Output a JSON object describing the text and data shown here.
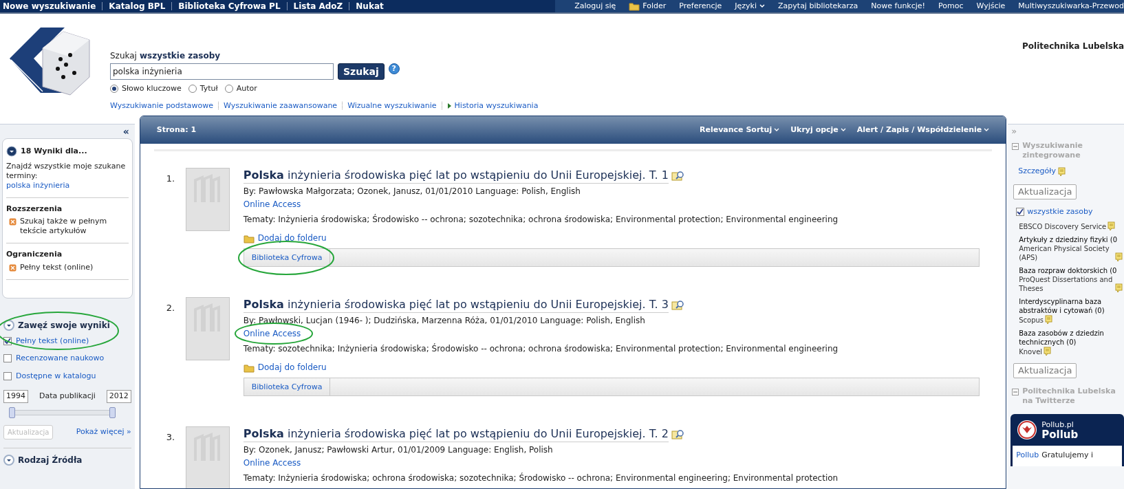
{
  "top_nav": {
    "left": [
      {
        "label": "Nowe wyszukiwanie"
      },
      {
        "label": "Katalog BPL"
      },
      {
        "label": "Biblioteka Cyfrowa PL"
      },
      {
        "label": "Lista AdoZ"
      },
      {
        "label": "Nukat"
      }
    ],
    "right": [
      {
        "label": "Zaloguj się",
        "kind": "plain"
      },
      {
        "label": "Folder",
        "kind": "folder"
      },
      {
        "label": "Preferencje",
        "kind": "plain"
      },
      {
        "label": "Języki",
        "kind": "dropdown"
      },
      {
        "label": "Zapytaj bibliotekarza",
        "kind": "plain"
      },
      {
        "label": "Nowe funkcje!",
        "kind": "plain"
      },
      {
        "label": "Pomoc",
        "kind": "plain"
      },
      {
        "label": "Wyjście",
        "kind": "plain"
      },
      {
        "label": "Multiwyszukiwarka-Przewod",
        "kind": "plain"
      }
    ]
  },
  "institution": "Politechnika Lubelska",
  "search": {
    "prefix": "Szukaj",
    "scope": "wszystkie zasoby",
    "value": "polska inżynieria",
    "button": "Szukaj",
    "help": "?",
    "options": [
      {
        "label": "Słowo kluczowe",
        "selected": true
      },
      {
        "label": "Tytuł",
        "selected": false
      },
      {
        "label": "Autor",
        "selected": false
      }
    ],
    "links": [
      {
        "label": "Wyszukiwanie podstawowe",
        "kind": "plain"
      },
      {
        "label": "Wyszukiwanie zaawansowane",
        "kind": "plain"
      },
      {
        "label": "Wizualne wyszukiwanie",
        "kind": "plain"
      },
      {
        "label": "Historia wyszukiwania",
        "kind": "arrow"
      }
    ]
  },
  "left_sidebar": {
    "collapse": "«",
    "results_heading": "18 Wyniki dla...",
    "find_text": "Znajdź wszystkie moje szukane terminy:",
    "query_link": "polska inżynieria",
    "sections": [
      {
        "heading": "Rozszerzenia",
        "items": [
          "Szukaj także w pełnym tekście artykułów"
        ]
      },
      {
        "heading": "Ograniczenia",
        "items": [
          "Pełny tekst (online)"
        ]
      }
    ],
    "narrow": {
      "heading": "Zawęź swoje wyniki",
      "circled": true,
      "filters": [
        {
          "label": "Pełny tekst (online)",
          "checked": true
        },
        {
          "label": "Recenzowane naukowo",
          "checked": false
        },
        {
          "label": "Dostępne w katalogu",
          "checked": false
        }
      ],
      "date_slider": {
        "thumbs": [
          {
            "level": 0
          },
          {
            "level": 1
          }
        ]
      },
      "date_from": "1994",
      "date_label": "Data publikacji",
      "date_to": "2012",
      "update_button": "Aktualizacja",
      "more_link": "Pokaż więcej »"
    },
    "next_heading": "Rodzaj Źródła"
  },
  "results": {
    "page_label": "Strona: 1",
    "toolbar": [
      "Relevance Sortuj",
      "Ukryj opcje",
      "Alert / Zapis / Współdzielenie"
    ],
    "items": [
      {
        "number": "1.",
        "title": "**Polska** inżynieria środowiska pięć lat po wstąpieniu do Unii Europejskiej. T. 1",
        "byline": "By: Pawłowska Małgorzata; Ozonek, Janusz, 01/01/2010 Language: Polish, English",
        "online_access": "Online Access",
        "access_circled": false,
        "subjects": "Tematy: Inżynieria środowiska; Środowisko -- ochrona; sozotechnika; ochrona środowiska; Environmental protection; Environmental engineering",
        "add_folder": "Dodaj do folderu",
        "source_tab": "Biblioteka Cyfrowa",
        "source_circled": true
      },
      {
        "number": "2.",
        "title": "**Polska** inżynieria środowiska pięć lat po wstąpieniu do Unii Europejskiej. T. 3",
        "byline": "By: Pawłowski, Lucjan (1946- ); Dudzińska, Marzenna Róża, 01/01/2010 Language: Polish, English",
        "online_access": "Online Access",
        "access_circled": true,
        "subjects": "Tematy: sozotechnika; Inżynieria środowiska; Środowisko -- ochrona; ochrona środowiska; Environmental protection; Environmental engineering",
        "add_folder": "Dodaj do folderu",
        "source_tab": "Biblioteka Cyfrowa",
        "source_circled": false
      },
      {
        "number": "3.",
        "title": "**Polska** inżynieria środowiska pięć lat po wstąpieniu do Unii Europejskiej. T. 2",
        "byline": "By: Ozonek, Janusz; Pawłowski Artur, 01/01/2009 Language: English, Polish",
        "online_access": "Online Access",
        "access_circled": false,
        "subjects": "Tematy: Inżynieria środowiska; ochrona środowiska; sozotechnika; Środowisko -- ochrona; Environmental engineering; Environmental protection"
      }
    ]
  },
  "right_sidebar": {
    "expand": "»",
    "integrated": {
      "heading": "Wyszukiwanie zintegrowane",
      "details": "Szczegóły",
      "update": "Aktualizacja",
      "all": {
        "label": "wszystkie zasoby",
        "checked": true
      },
      "sources": [
        {
          "name": "EBSCO Discovery Service"
        },
        {
          "category": "Artykuły z dziedziny fizyki (0",
          "name": "American Physical Society (APS)"
        },
        {
          "category": "Baza rozpraw doktorskich (0",
          "name": "ProQuest Dissertations and Theses"
        },
        {
          "category": "Interdyscyplinarna baza abstraktów i cytowań (0)",
          "name": "Scopus"
        },
        {
          "category": "Baza zasobów z dziedzin technicznych (0)",
          "name": "Knovel"
        }
      ],
      "update2": "Aktualizacja"
    },
    "twitter_heading": "Politechnika Lubelska na Twitterze",
    "widget": {
      "handle": "Pollub.pl",
      "name": "Pollub",
      "tweet_user": "Pollub",
      "tweet_text": "Gratulujemy i"
    }
  }
}
